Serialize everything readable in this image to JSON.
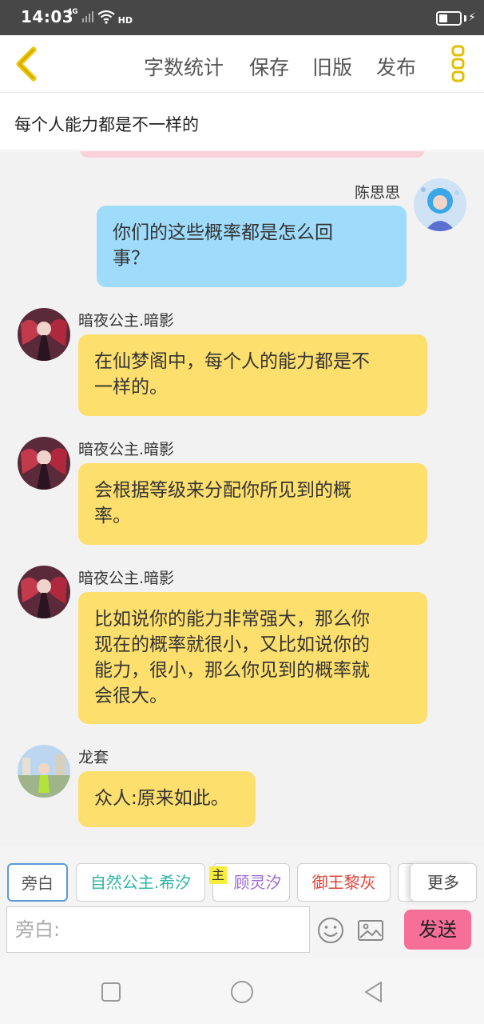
{
  "status": {
    "time": "14:03",
    "network": "4G",
    "hd": "HD"
  },
  "topbar": {
    "nav": [
      "字数统计",
      "保存",
      "旧版",
      "发布"
    ]
  },
  "subtitle": "每个人能力都是不一样的",
  "messages": [
    {
      "name": "陈思思",
      "side": "right",
      "lines": [
        "你们的这些概率都是怎么回",
        "事？"
      ]
    },
    {
      "name": "暗夜公主.暗影",
      "side": "left",
      "lines": [
        "在仙梦阁中，每个人的能力都是不",
        "一样的。"
      ]
    },
    {
      "name": "暗夜公主.暗影",
      "side": "left",
      "lines": [
        "会根据等级来分配你所见到的概",
        "率。"
      ]
    },
    {
      "name": "暗夜公主.暗影",
      "side": "left",
      "lines": [
        "比如说你的能力非常强大，那么你",
        "现在的概率就很小，又比如说你的",
        "能力，很小，那么你见到的概率就",
        "会很大。"
      ]
    },
    {
      "name": "龙套",
      "side": "left",
      "lines": [
        "众人:原来如此。"
      ]
    }
  ],
  "characters": [
    {
      "label": "旁白",
      "color": "#555555"
    },
    {
      "label": "自然公主.希汐",
      "color": "#2fb6a6"
    },
    {
      "label": "顾灵汐",
      "color": "#9b6ad6"
    },
    {
      "label": "御王黎灰",
      "color": "#d9453a"
    }
  ],
  "tag_main": "主",
  "more_label": "更多",
  "input": {
    "placeholder": "旁白:"
  },
  "send_label": "发送",
  "colors": {
    "accent_yellow": "#fddf6e",
    "bubble_blue": "#9fdcfb",
    "send_pink": "#f66f98",
    "back_arrow": "#f0c808"
  },
  "icons": [
    "back-arrow-icon",
    "more-vertical-icon",
    "emoji-icon",
    "image-icon",
    "nav-square-icon",
    "nav-circle-icon",
    "nav-back-triangle-icon"
  ]
}
